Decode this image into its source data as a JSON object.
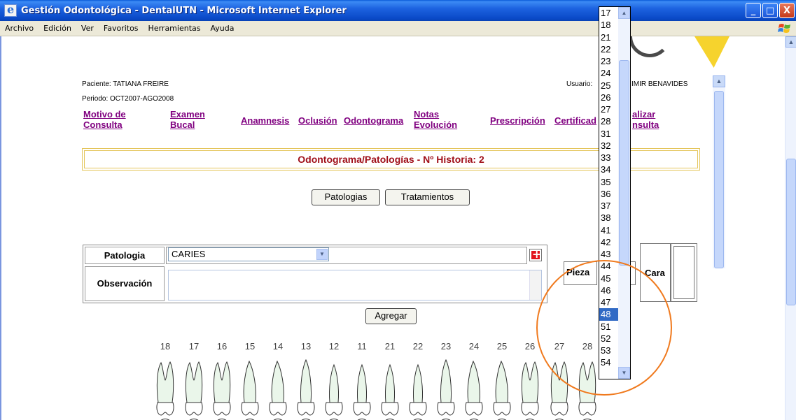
{
  "window": {
    "title": "Gestión Odontológica - DentalUTN - Microsoft Internet Explorer",
    "min_label": "_",
    "max_label": "□",
    "close_label": "X"
  },
  "menu": [
    "Archivo",
    "Edición",
    "Ver",
    "Favoritos",
    "Herramientas",
    "Ayuda"
  ],
  "header": {
    "paciente": "Paciente: TATIANA FREIRE",
    "periodo": "Periodo: OCT2007-AGO2008",
    "usuario_label": "Usuario:",
    "usuario_name": "IMIR BENAVIDES"
  },
  "nav": {
    "motivo_1": "Motivo de",
    "motivo_2": "Consulta",
    "examen_1": "Examen",
    "examen_2": "Bucal",
    "anamnesis": "Anamnesis",
    "oclusion": "Oclusión",
    "odontograma": "Odontograma",
    "notas_1": "Notas",
    "notas_2": "Evolución",
    "prescripcion": "Prescripción",
    "certificado": "Certificad",
    "finalizar_1": "alizar",
    "finalizar_2": "nsulta"
  },
  "section_title": "Odontograma/Patologías - Nº Historia: 2",
  "tabs": {
    "patologias": "Patologias",
    "tratamientos": "Tratamientos"
  },
  "form": {
    "patologia_label": "Patologia",
    "patologia_value": "CARIES",
    "observacion_label": "Observación",
    "observacion_value": "",
    "agregar": "Agregar",
    "pieza_label": "Pieza",
    "cara_label": "Cara"
  },
  "teeth_numbers": [
    "18",
    "17",
    "16",
    "15",
    "14",
    "13",
    "12",
    "11",
    "21",
    "22",
    "23",
    "24",
    "25",
    "26",
    "27",
    "28"
  ],
  "dropdown": {
    "options": [
      "17",
      "18",
      "21",
      "22",
      "23",
      "24",
      "25",
      "26",
      "27",
      "28",
      "31",
      "32",
      "33",
      "34",
      "35",
      "36",
      "37",
      "38",
      "41",
      "42",
      "43",
      "44",
      "45",
      "46",
      "47",
      "48",
      "51",
      "52",
      "53",
      "54"
    ],
    "selected": "48"
  },
  "colors": {
    "accent_link": "#800080",
    "title_red": "#a0101a",
    "highlight_circle": "#f07a1e",
    "selection": "#316ac5"
  }
}
